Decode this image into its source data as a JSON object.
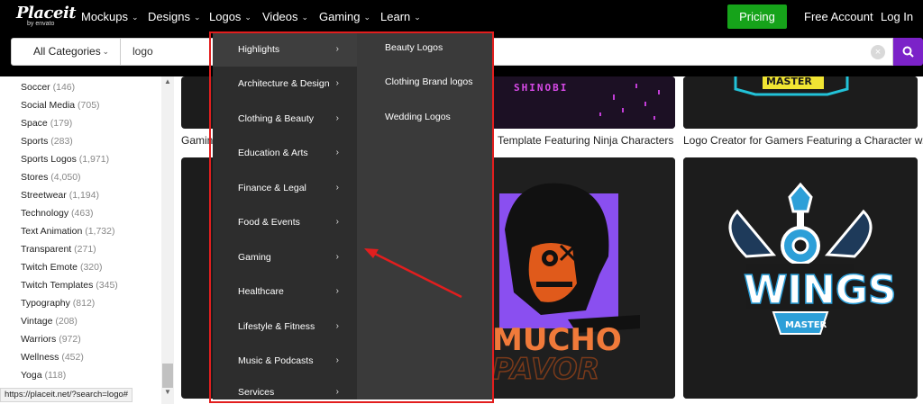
{
  "topnav": {
    "logo": "Placeit",
    "logo_sub": "by envato",
    "items": [
      {
        "label": "Mockups"
      },
      {
        "label": "Designs"
      },
      {
        "label": "Logos"
      },
      {
        "label": "Videos"
      },
      {
        "label": "Gaming"
      },
      {
        "label": "Learn"
      }
    ],
    "pricing": "Pricing",
    "free_account": "Free Account",
    "login": "Log In",
    "chevron": "⌄"
  },
  "search": {
    "category": "All Categories",
    "value": "logo",
    "clear_glyph": "×"
  },
  "sidebar": {
    "items": [
      {
        "label": "Soccer",
        "count": "(146)"
      },
      {
        "label": "Social Media",
        "count": "(705)"
      },
      {
        "label": "Space",
        "count": "(179)"
      },
      {
        "label": "Sports",
        "count": "(283)"
      },
      {
        "label": "Sports Logos",
        "count": "(1,971)"
      },
      {
        "label": "Stores",
        "count": "(4,050)"
      },
      {
        "label": "Streetwear",
        "count": "(1,194)"
      },
      {
        "label": "Technology",
        "count": "(463)"
      },
      {
        "label": "Text Animation",
        "count": "(1,732)"
      },
      {
        "label": "Transparent",
        "count": "(271)"
      },
      {
        "label": "Twitch Emote",
        "count": "(320)"
      },
      {
        "label": "Twitch Templates",
        "count": "(345)"
      },
      {
        "label": "Typography",
        "count": "(812)"
      },
      {
        "label": "Vintage",
        "count": "(208)"
      },
      {
        "label": "Warriors",
        "count": "(972)"
      },
      {
        "label": "Wellness",
        "count": "(452)"
      },
      {
        "label": "Yoga",
        "count": "(118)"
      }
    ]
  },
  "status_url": "https://placeit.net/?search=logo#",
  "cards": {
    "top_left_caption": "Gamin",
    "top_mid_caption": "Template Featuring Ninja Characters",
    "top_right_caption": "Logo Creator for Gamers Featuring a Character w...",
    "shinobi_text": "SHINOBI",
    "master_text": "MASTER",
    "mucho_text": "MUCHO",
    "pavor_text": "PAVOR",
    "wings_text": "WINGS",
    "wings_master": "MASTER"
  },
  "dropdown": {
    "categories": [
      {
        "label": "Highlights"
      },
      {
        "label": "Architecture & Design"
      },
      {
        "label": "Clothing & Beauty"
      },
      {
        "label": "Education & Arts"
      },
      {
        "label": "Finance & Legal"
      },
      {
        "label": "Food & Events"
      },
      {
        "label": "Gaming"
      },
      {
        "label": "Healthcare"
      },
      {
        "label": "Lifestyle & Fitness"
      },
      {
        "label": "Music & Podcasts"
      },
      {
        "label": "Services"
      }
    ],
    "arrow": "›",
    "subitems": [
      {
        "label": "Beauty Logos"
      },
      {
        "label": "Clothing Brand logos"
      },
      {
        "label": "Wedding Logos"
      }
    ]
  },
  "colors": {
    "pricing_green": "#16a31a",
    "search_purple": "#7b22c8",
    "highlight_red": "#e21e1e"
  }
}
